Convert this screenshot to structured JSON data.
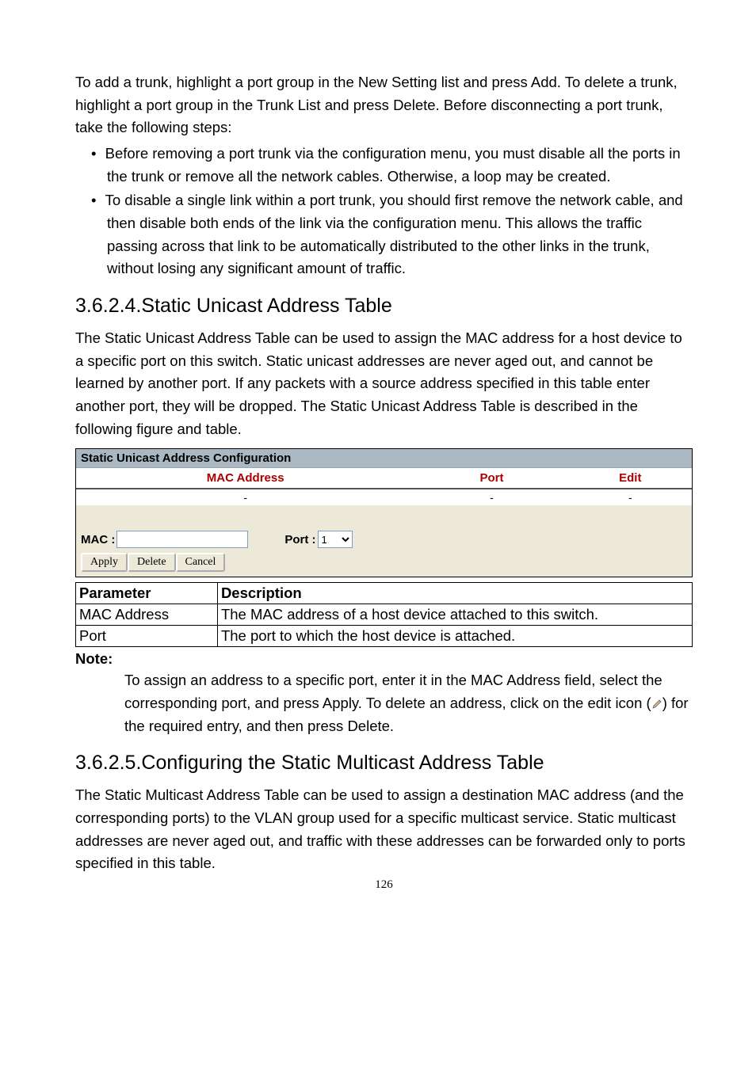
{
  "intro": "To add a trunk, highlight a port group in the New Setting list and press Add. To delete a trunk, highlight a port group in the Trunk List and press Delete. Before disconnecting a port trunk, take the following steps:",
  "bullets": [
    "Before removing a port trunk via the configuration menu, you must disable all the ports in the trunk or remove all the network cables. Otherwise, a loop may be created.",
    "To disable a single link within a port trunk, you should first remove the network cable, and then disable both ends of the link via the configuration menu. This allows the traffic passing across that link to be automatically distributed to the other links in the trunk, without losing any significant amount of traffic."
  ],
  "section1": {
    "heading": "3.6.2.4.Static Unicast Address Table",
    "para": "The Static Unicast Address Table can be used to assign the MAC address for a host device to a specific port on this switch. Static unicast addresses are never aged out, and cannot be learned by another port. If any packets with a source address specified in this table enter another port, they will be dropped. The Static Unicast Address Table is described in the following figure and table."
  },
  "configbox": {
    "title": "Static Unicast Address Configuration",
    "headers": {
      "mac": "MAC Address",
      "port": "Port",
      "edit": "Edit"
    },
    "row": {
      "mac": "-",
      "port": "-",
      "edit": "-"
    },
    "form": {
      "mac_label": "MAC :",
      "port_label": "Port :",
      "port_value": "1",
      "apply": "Apply",
      "delete": "Delete",
      "cancel": "Cancel"
    }
  },
  "paramtable": {
    "h_param": "Parameter",
    "h_desc": "Description",
    "rows": [
      {
        "p": "MAC Address",
        "d": "The MAC address of a host device attached to this switch."
      },
      {
        "p": "Port",
        "d": "The port to which the host device is attached."
      }
    ]
  },
  "note": {
    "label": "Note:",
    "text_before": "To assign an address to a specific port, enter it in the MAC Address field, select the corresponding port, and press Apply. To delete an address, click on the edit icon (",
    "text_after": ") for the required entry, and then press Delete."
  },
  "section2": {
    "heading": "3.6.2.5.Configuring the Static Multicast Address Table",
    "para": "The Static Multicast Address Table can be used to assign a destination MAC address (and the corresponding ports) to the VLAN group used for a specific multicast service. Static multicast addresses are never aged out, and traffic with these addresses can be forwarded only to ports specified in this table."
  },
  "page_number": "126"
}
